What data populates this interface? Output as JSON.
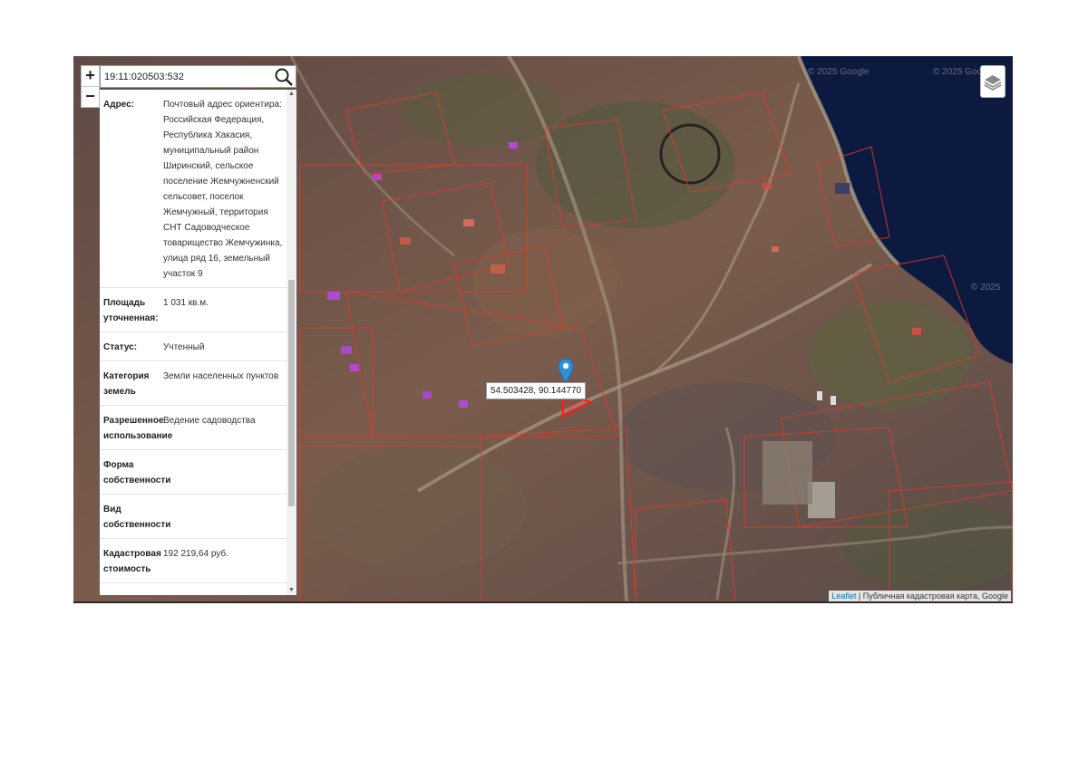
{
  "search": {
    "value": "19:11:020503:532"
  },
  "zoom": {
    "in_label": "+",
    "out_label": "−"
  },
  "info_rows": [
    {
      "key": "Адрес:",
      "value": "Почтовый адрес ориентира: Российская Федерация, Республика Хакасия, муниципальный район Ширинский, сельское поселение Жемчужненский сельсовет, поселок Жемчужный, территория СНТ Садоводческое товарищество Жемчужинка, улица ряд 16, земельный участок 9"
    },
    {
      "key": "Площадь уточненная:",
      "value": "1 031 кв.м."
    },
    {
      "key": "Статус:",
      "value": "Учтенный"
    },
    {
      "key": "Категория земель",
      "value": "Земли населенных пунктов"
    },
    {
      "key": "Разрешенное использование",
      "value": "Ведение садоводства"
    },
    {
      "key": "Форма собственности",
      "value": ""
    },
    {
      "key": "Вид собственности",
      "value": ""
    },
    {
      "key": "Кадастровая стоимость",
      "value": "192 219,64 руб."
    }
  ],
  "popup": {
    "coords": "54.503428, 90.144770"
  },
  "attribution": {
    "leaflet": "Leaflet",
    "rest": " | Публичная кадастровая карта, Google"
  },
  "watermarks": [
    "© 2025 Google",
    "© 2025 Google",
    "© 2025 G",
    "© 2025"
  ],
  "icons": {
    "search": "search-icon",
    "layers": "layers-icon",
    "marker": "map-pin-icon"
  },
  "colors": {
    "parcel_line": "#e0392b",
    "water": "#0d1a3f",
    "selected_parcel": "#ff1a1a"
  }
}
